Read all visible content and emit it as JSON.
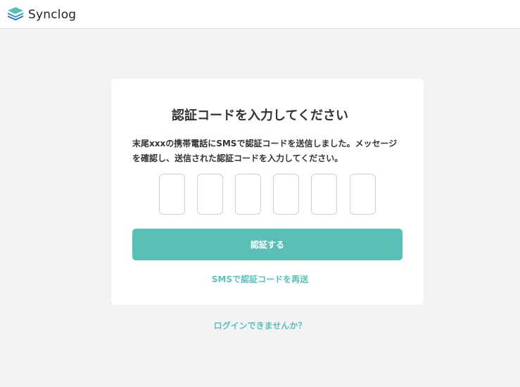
{
  "header": {
    "brand_name": "Synclog",
    "logo_icon": "layers-icon"
  },
  "card": {
    "title": "認証コードを入力してください",
    "description": "末尾xxxの携帯電話にSMSで認証コードを送信しました。メッセージを確認し、送信された認証コードを入力してください。",
    "code_inputs": [
      "",
      "",
      "",
      "",
      "",
      ""
    ],
    "verify_button_label": "認証する",
    "resend_link_label": "SMSで認証コードを再送"
  },
  "footer": {
    "cant_login_label": "ログインできませんか？"
  },
  "colors": {
    "accent": "#5bbfb8",
    "background": "#f3f3f5",
    "logo_dark": "#1f7fbf",
    "logo_light": "#5bbfb8"
  }
}
